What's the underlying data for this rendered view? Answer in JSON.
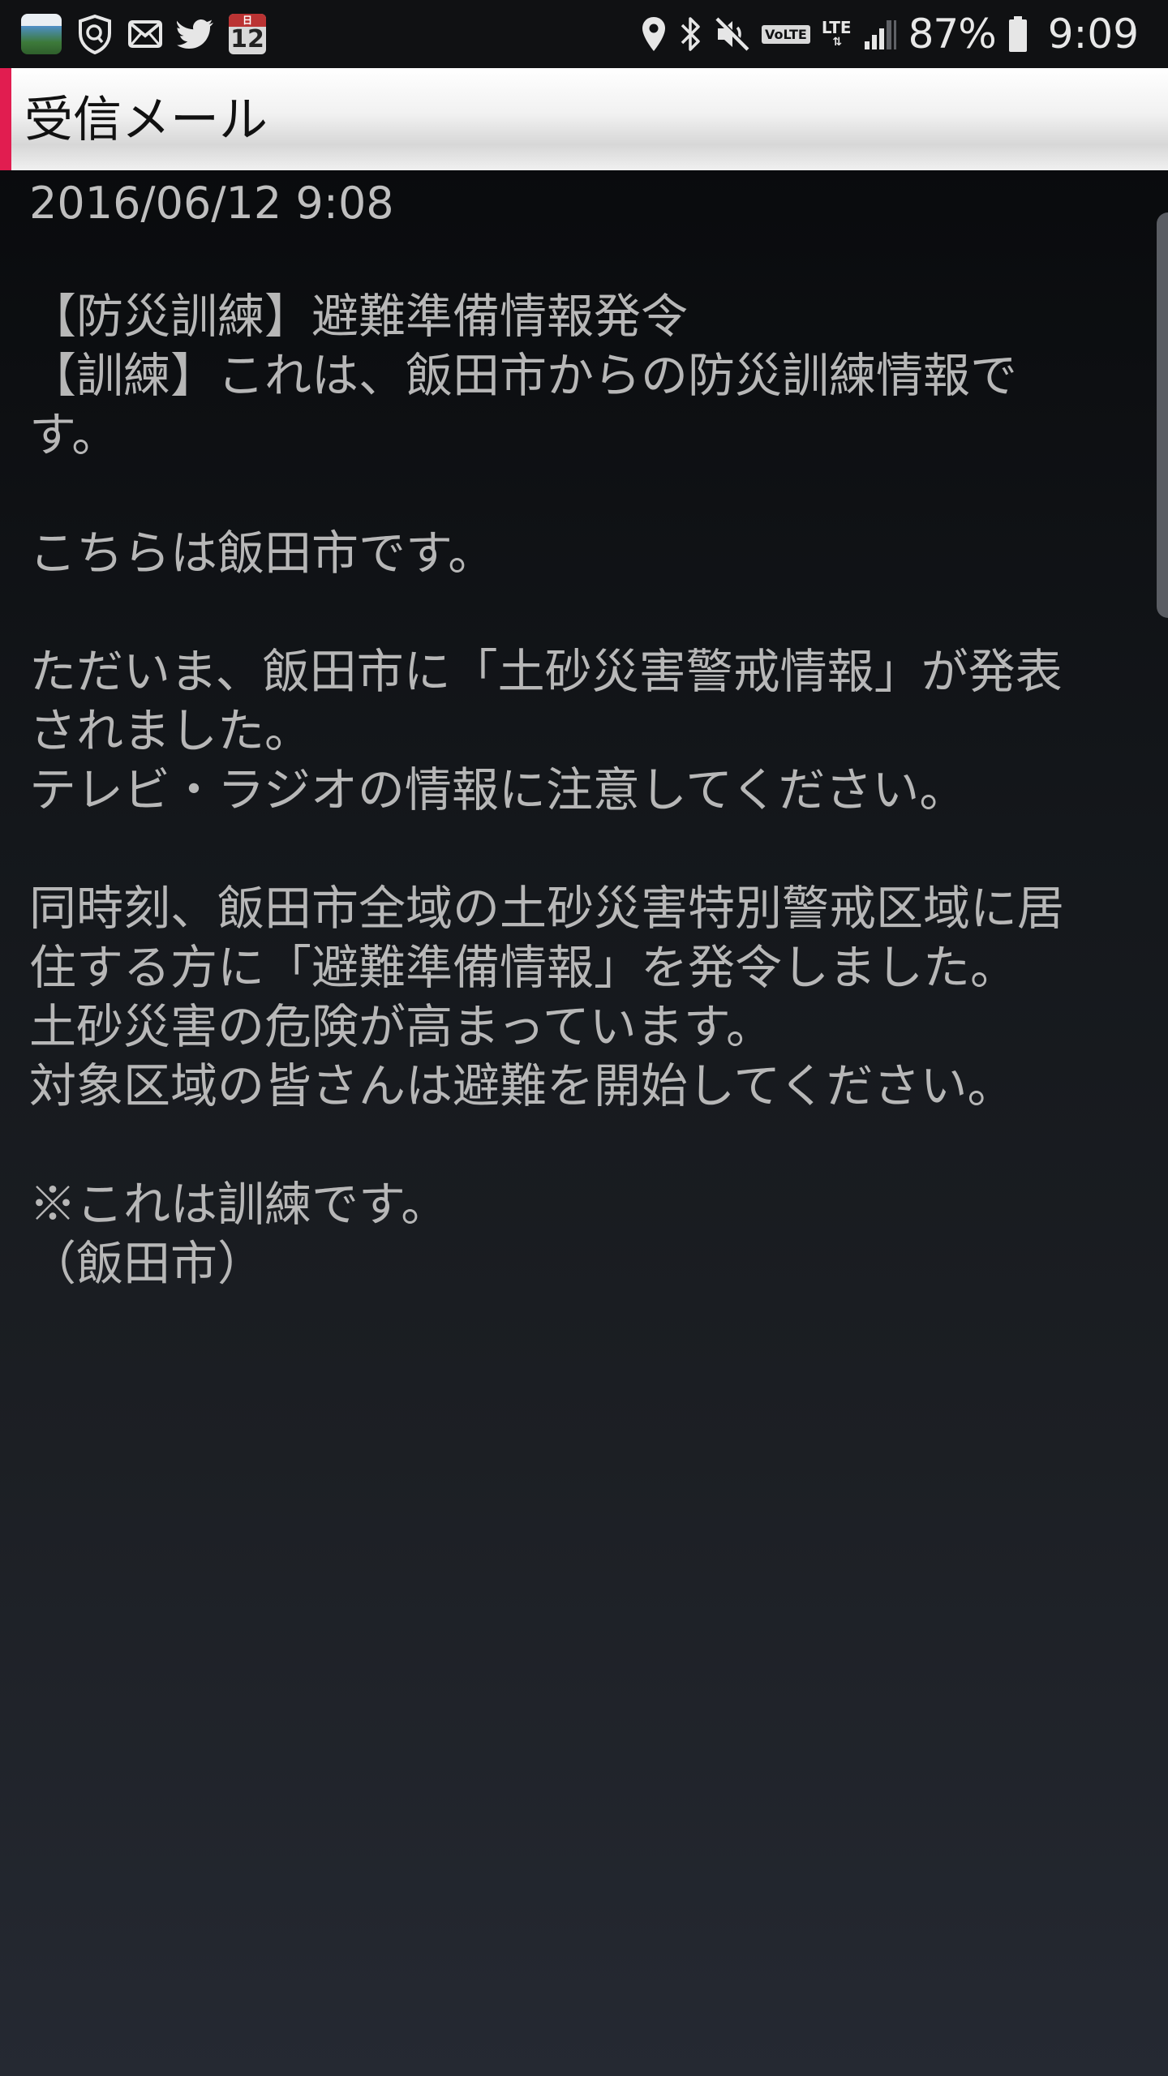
{
  "status_bar": {
    "left_icons": [
      "app-icon",
      "shield-icon",
      "mail-icon",
      "twitter-icon",
      "calendar-icon"
    ],
    "calendar_day": "12",
    "calendar_label": "日",
    "right_icons": [
      "location-icon",
      "bluetooth-icon",
      "mute-icon",
      "volte-icon",
      "lte-icon",
      "signal-icon",
      "battery-icon"
    ],
    "volte_label": "VoLTE",
    "lte_label": "LTE",
    "battery_percent": "87%",
    "battery_level": 0.87,
    "time": "9:09"
  },
  "header": {
    "title": "受信メール",
    "accent_color": "#e11d50"
  },
  "message": {
    "date": "2016/06/12 9:08",
    "body": "【防災訓練】避難準備情報発令\n【訓練】これは、飯田市からの防災訓練情報で\nす。\n\nこちらは飯田市です。\n\nただいま、飯田市に「土砂災害警戒情報」が発表\nされました。\nテレビ・ラジオの情報に注意してください。\n\n同時刻、飯田市全域の土砂災害特別警戒区域に居\n住する方に「避難準備情報」を発令しました。\n土砂災害の危険が高まっています。\n対象区域の皆さんは避難を開始してください。\n\n※これは訓練です。\n（飯田市）"
  }
}
